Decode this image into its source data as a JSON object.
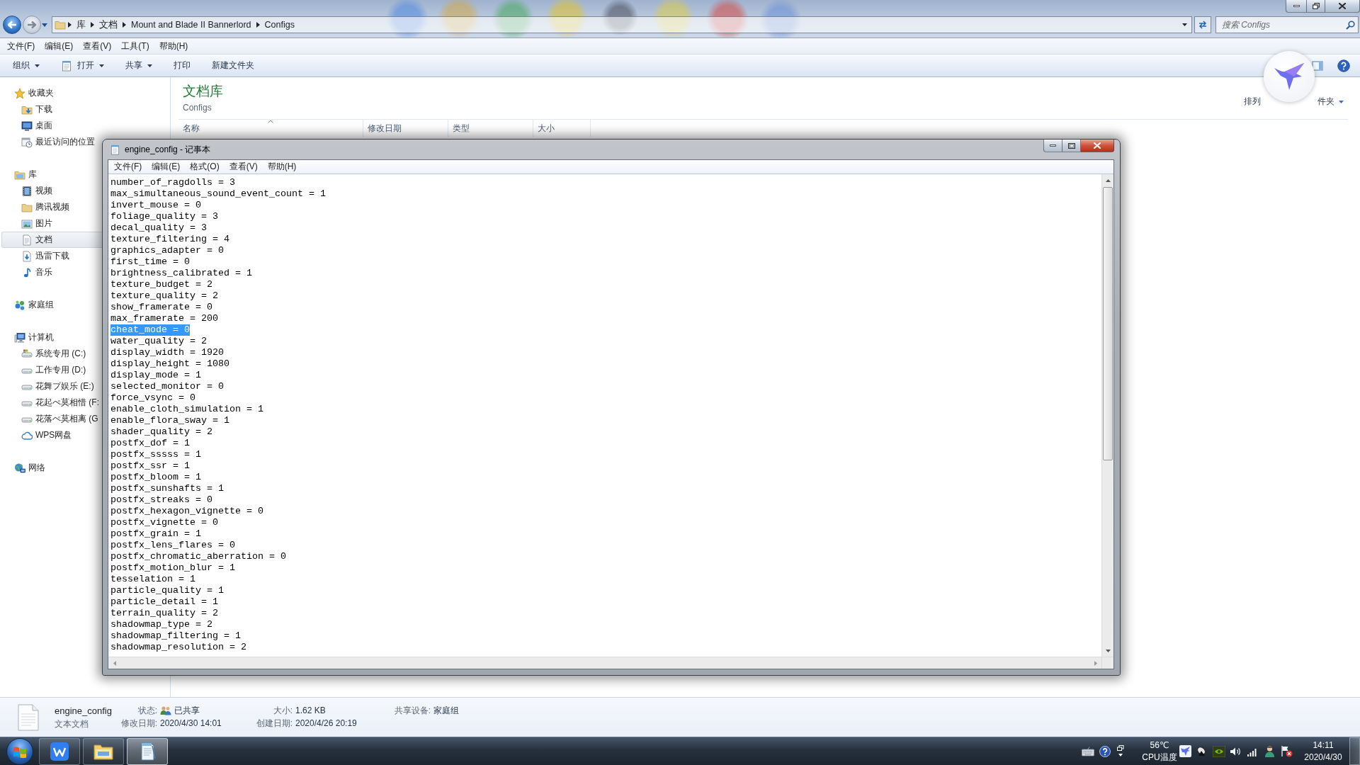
{
  "explorer": {
    "active": false,
    "nav_buttons": [
      {
        "kind": "back",
        "disabled": false
      },
      {
        "kind": "forward",
        "disabled": true
      }
    ],
    "address_bar": {
      "segments": [
        "库",
        "文档",
        "Mount and Blade II Bannerlord",
        "Configs"
      ]
    },
    "search": {
      "placeholder": "搜索 Configs"
    },
    "menu": [
      "文件(F)",
      "编辑(E)",
      "查看(V)",
      "工具(T)",
      "帮助(H)"
    ],
    "toolbar": [
      {
        "label": "组织",
        "kind": "dropdown"
      },
      {
        "label": "打开",
        "kind": "icondropdown"
      },
      {
        "label": "共享",
        "kind": "dropdown"
      },
      {
        "label": "打印",
        "kind": "plain"
      },
      {
        "label": "新建文件夹",
        "kind": "plain"
      }
    ],
    "sidebar": [
      {
        "label": "收藏夹",
        "kind": "favorites",
        "selected": false,
        "children": [
          {
            "label": "下载",
            "kind": "downloads",
            "selected": false
          },
          {
            "label": "桌面",
            "kind": "desktop",
            "selected": false
          },
          {
            "label": "最近访问的位置",
            "kind": "recent",
            "selected": false
          }
        ]
      },
      {
        "label": "库",
        "kind": "libraries",
        "selected": false,
        "children": [
          {
            "label": "视频",
            "kind": "videos",
            "selected": false
          },
          {
            "label": "腾讯视频",
            "kind": "folder",
            "selected": false
          },
          {
            "label": "图片",
            "kind": "pictures",
            "selected": false
          },
          {
            "label": "文档",
            "kind": "documents",
            "selected": true
          },
          {
            "label": "迅雷下载",
            "kind": "transfer",
            "selected": false
          },
          {
            "label": "音乐",
            "kind": "music",
            "selected": false
          }
        ]
      },
      {
        "label": "家庭组",
        "kind": "homegroup",
        "selected": false
      },
      {
        "label": "计算机",
        "kind": "computer",
        "selected": false,
        "children": [
          {
            "label": "系统专用 (C:)",
            "kind": "sysdrive",
            "selected": false
          },
          {
            "label": "工作专用 (D:)",
            "kind": "drive",
            "selected": false
          },
          {
            "label": "花舞プ娱乐 (E:)",
            "kind": "drive",
            "selected": false
          },
          {
            "label": "花起ぺ莫相惜 (F:",
            "kind": "drive",
            "selected": false
          },
          {
            "label": "花落ぺ莫相离 (G",
            "kind": "drive",
            "selected": false
          },
          {
            "label": "WPS网盘",
            "kind": "cloud",
            "selected": false
          }
        ]
      },
      {
        "label": "网络",
        "kind": "network",
        "selected": false
      }
    ],
    "library": {
      "title": "文档库",
      "subtitle": "Configs",
      "arrange_parts": [
        "排列",
        "件夹"
      ]
    },
    "columns": [
      {
        "label": "名称",
        "sorted": true
      },
      {
        "label": "修改日期",
        "sorted": false
      },
      {
        "label": "类型",
        "sorted": false
      },
      {
        "label": "大小",
        "sorted": false
      }
    ],
    "details": {
      "name": "engine_config",
      "type": "文本文档",
      "columns": [
        [
          {
            "label": "状态:",
            "value": "已共享",
            "kind": "shared"
          },
          {
            "label": "修改日期:",
            "value": "2020/4/30 14:01",
            "kind": "text"
          }
        ],
        [
          {
            "label": "大小:",
            "value": "1.62 KB",
            "kind": "text"
          },
          {
            "label": "创建日期:",
            "value": "2020/4/26 20:19",
            "kind": "text"
          }
        ],
        [
          {
            "label": "共享设备:",
            "value": "家庭组",
            "kind": "text"
          }
        ]
      ]
    }
  },
  "notepad": {
    "active": true,
    "title": "engine_config - 记事本",
    "menu": [
      "文件(F)",
      "编辑(E)",
      "格式(O)",
      "查看(V)",
      "帮助(H)"
    ],
    "lines": [
      {
        "text": "number_of_ragdolls = 3",
        "selected": false
      },
      {
        "text": "max_simultaneous_sound_event_count = 1",
        "selected": false
      },
      {
        "text": "invert_mouse = 0",
        "selected": false
      },
      {
        "text": "foliage_quality = 3",
        "selected": false
      },
      {
        "text": "decal_quality = 3",
        "selected": false
      },
      {
        "text": "texture_filtering = 4",
        "selected": false
      },
      {
        "text": "graphics_adapter = 0",
        "selected": false
      },
      {
        "text": "first_time = 0",
        "selected": false
      },
      {
        "text": "brightness_calibrated = 1",
        "selected": false
      },
      {
        "text": "texture_budget = 2",
        "selected": false
      },
      {
        "text": "texture_quality = 2",
        "selected": false
      },
      {
        "text": "show_framerate = 0",
        "selected": false
      },
      {
        "text": "max_framerate = 200",
        "selected": false
      },
      {
        "text": "cheat_mode = 0",
        "selected": true
      },
      {
        "text": "water_quality = 2",
        "selected": false
      },
      {
        "text": "display_width = 1920",
        "selected": false
      },
      {
        "text": "display_height = 1080",
        "selected": false
      },
      {
        "text": "display_mode = 1",
        "selected": false
      },
      {
        "text": "selected_monitor = 0",
        "selected": false
      },
      {
        "text": "force_vsync = 0",
        "selected": false
      },
      {
        "text": "enable_cloth_simulation = 1",
        "selected": false
      },
      {
        "text": "enable_flora_sway = 1",
        "selected": false
      },
      {
        "text": "shader_quality = 2",
        "selected": false
      },
      {
        "text": "postfx_dof = 1",
        "selected": false
      },
      {
        "text": "postfx_sssss = 1",
        "selected": false
      },
      {
        "text": "postfx_ssr = 1",
        "selected": false
      },
      {
        "text": "postfx_bloom = 1",
        "selected": false
      },
      {
        "text": "postfx_sunshafts = 1",
        "selected": false
      },
      {
        "text": "postfx_streaks = 0",
        "selected": false
      },
      {
        "text": "postfx_hexagon_vignette = 0",
        "selected": false
      },
      {
        "text": "postfx_vignette = 0",
        "selected": false
      },
      {
        "text": "postfx_grain = 1",
        "selected": false
      },
      {
        "text": "postfx_lens_flares = 0",
        "selected": false
      },
      {
        "text": "postfx_chromatic_aberration = 0",
        "selected": false
      },
      {
        "text": "postfx_motion_blur = 1",
        "selected": false
      },
      {
        "text": "tesselation = 1",
        "selected": false
      },
      {
        "text": "particle_quality = 1",
        "selected": false
      },
      {
        "text": "particle_detail = 1",
        "selected": false
      },
      {
        "text": "terrain_quality = 2",
        "selected": false
      },
      {
        "text": "shadowmap_type = 2",
        "selected": false
      },
      {
        "text": "shadowmap_filtering = 1",
        "selected": false
      },
      {
        "text": "shadowmap_resolution = 2",
        "selected": false
      }
    ]
  },
  "taskbar": {
    "apps": [
      {
        "kind": "office",
        "selected": false
      },
      {
        "kind": "files",
        "selected": false
      },
      {
        "kind": "notepad",
        "selected": true
      }
    ],
    "cpu_temperature": {
      "value": "56℃",
      "label": "CPU温度"
    },
    "clock": {
      "time": "14:11",
      "date": "2020/4/30"
    }
  }
}
